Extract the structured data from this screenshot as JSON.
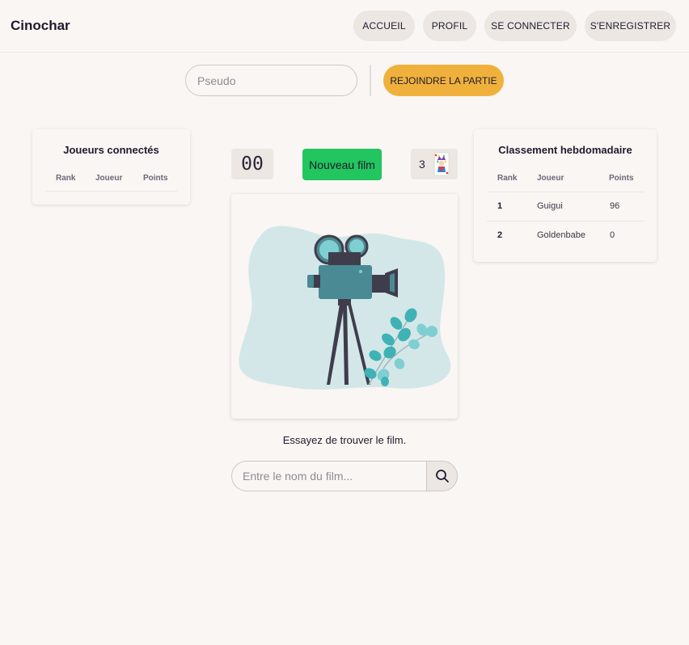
{
  "header": {
    "brand": "Cinochar",
    "nav": {
      "accueil": "ACCUEIL",
      "profil": "PROFIL",
      "connect": "SE CONNECTER",
      "register": "S'ENREGISTRER"
    }
  },
  "join": {
    "pseudo_placeholder": "Pseudo",
    "button": "REJOINDRE LA PARTIE"
  },
  "connected": {
    "title": "Joueurs connectés",
    "columns": [
      "Rank",
      "Joueur",
      "Points"
    ]
  },
  "game": {
    "timer": "00",
    "new_film": "Nouveau film",
    "jokers": "3",
    "joker_icon": "joker-card-icon",
    "poster_icon": "film-camera-illustration",
    "hint": "Essayez de trouver le film.",
    "search_placeholder": "Entre le nom du film...",
    "search_icon": "search-icon"
  },
  "weekly": {
    "title": "Classement hebdomadaire",
    "columns": [
      "Rank",
      "Joueur",
      "Points"
    ],
    "rows": [
      {
        "rank": "1",
        "player": "Guigui",
        "points": "96"
      },
      {
        "rank": "2",
        "player": "Goldenbabe",
        "points": "0"
      }
    ]
  },
  "colors": {
    "background": "#faf6f3",
    "accent_yellow": "#f0b13c",
    "accent_green": "#22c55e",
    "button_gray": "#ece7e3"
  }
}
